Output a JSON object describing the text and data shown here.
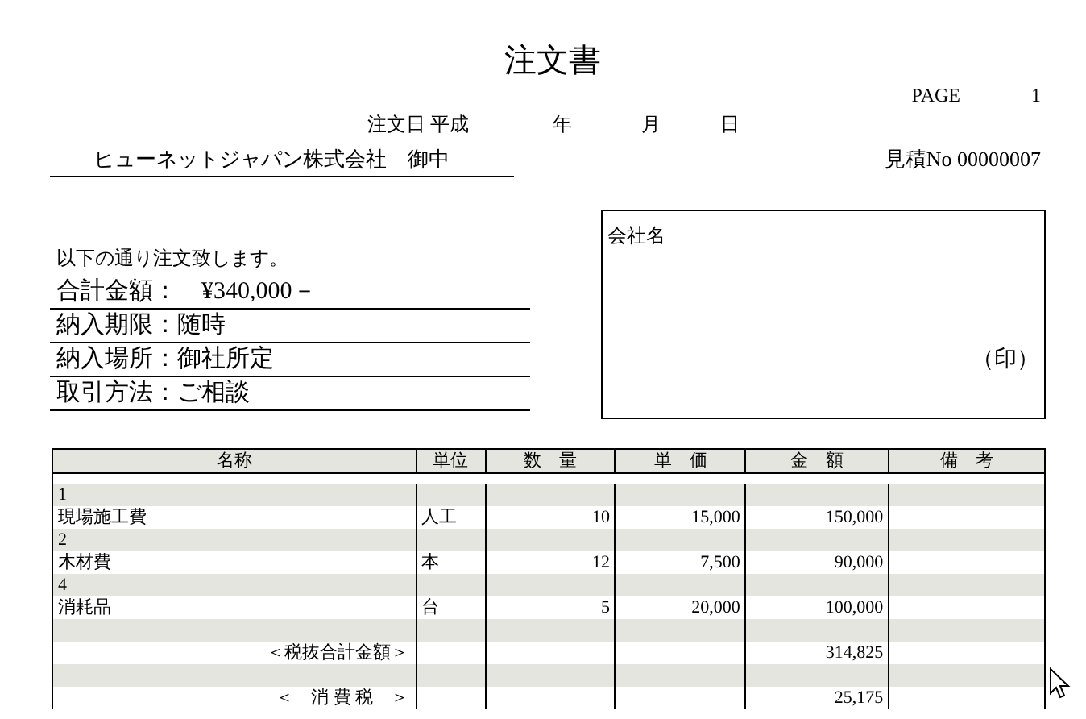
{
  "title": "注文書",
  "page": {
    "label": "PAGE",
    "number": "1"
  },
  "order_date": {
    "label": "注文日 平成",
    "year": "年",
    "month": "月",
    "day": "日"
  },
  "recipient": "ヒューネットジャパン株式会社　御中",
  "estimate_no": "見積No 00000007",
  "intro": "以下の通り注文致します。",
  "terms": [
    "合計金額：　¥340,000－",
    "納入期限：随時",
    "納入場所：御社所定",
    "取引方法：ご相談"
  ],
  "company_box": {
    "label": "会社名",
    "seal": "（印）"
  },
  "table": {
    "columns": [
      "名称",
      "単位",
      "数　量",
      "単　価",
      "金　額",
      "備　考"
    ],
    "rows": [
      {
        "kind": "item",
        "cells": [
          "1",
          "",
          "",
          "",
          "",
          ""
        ]
      },
      {
        "kind": "item",
        "cells": [
          "現場施工費",
          "人工",
          "10",
          "15,000",
          "150,000",
          ""
        ]
      },
      {
        "kind": "item",
        "cells": [
          "2",
          "",
          "",
          "",
          "",
          ""
        ]
      },
      {
        "kind": "item",
        "cells": [
          "木材費",
          "本",
          "12",
          "7,500",
          "90,000",
          ""
        ]
      },
      {
        "kind": "item",
        "cells": [
          "4",
          "",
          "",
          "",
          "",
          ""
        ]
      },
      {
        "kind": "item",
        "cells": [
          "消耗品",
          "台",
          "5",
          "20,000",
          "100,000",
          ""
        ]
      },
      {
        "kind": "item",
        "cells": [
          "",
          "",
          "",
          "",
          "",
          ""
        ]
      },
      {
        "kind": "summary",
        "cells": [
          "＜税抜合計金額＞",
          "",
          "",
          "",
          "314,825",
          ""
        ]
      },
      {
        "kind": "item",
        "cells": [
          "",
          "",
          "",
          "",
          "",
          ""
        ]
      },
      {
        "kind": "summary",
        "cells": [
          "＜　消 費 税　＞",
          "",
          "",
          "",
          "25,175",
          ""
        ]
      }
    ]
  }
}
